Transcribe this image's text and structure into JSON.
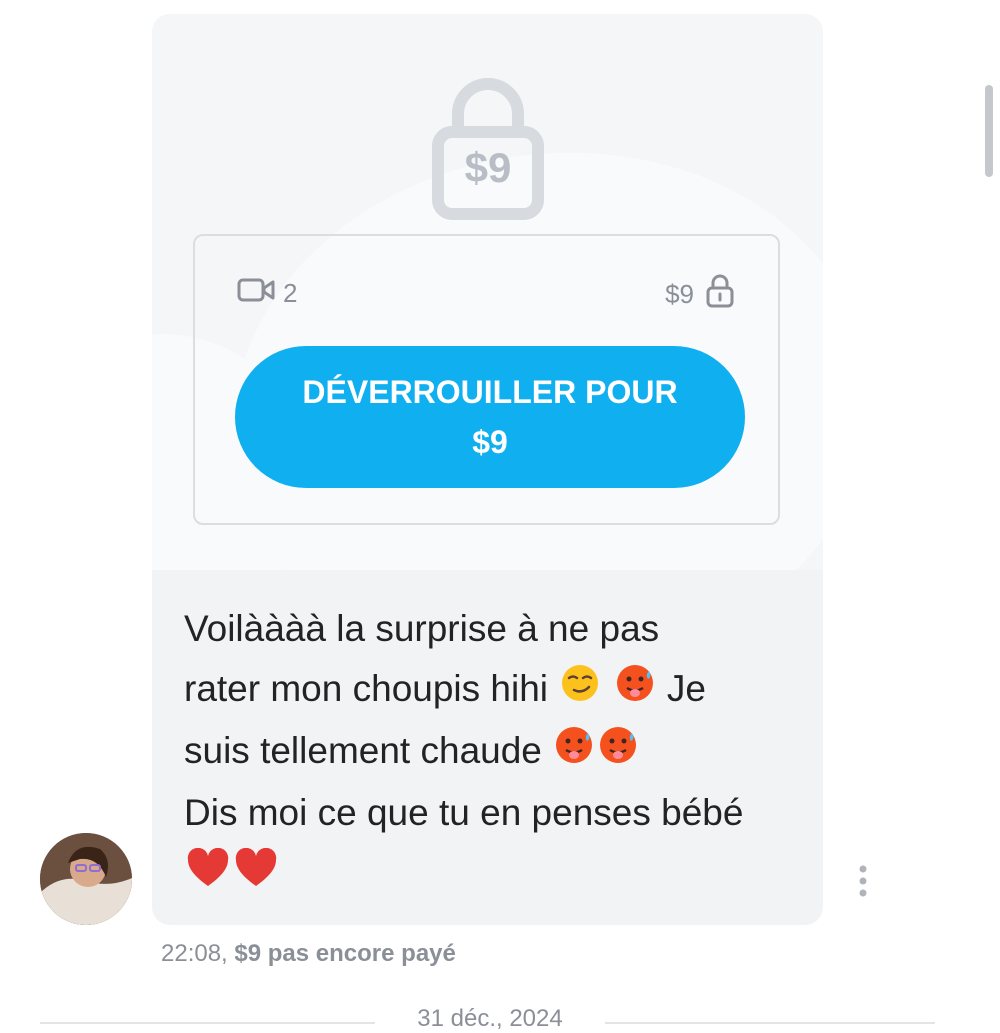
{
  "locked_post": {
    "lock_price": "$9",
    "video_count": "2",
    "price_label": "$9",
    "unlock_button": {
      "line1": "DÉVERROUILLER POUR",
      "line2": "$9"
    }
  },
  "message": {
    "line1": "Voilàààà la surprise à ne pas",
    "line2_text": "rater mon choupis hihi",
    "line2_suffix": "Je",
    "line3_text": "suis tellement chaude",
    "line4": "Dis moi ce que tu en penses bébé"
  },
  "meta": {
    "time": "22:08,",
    "payment_status": "$9 pas encore payé"
  },
  "date_separator": "31 déc., 2024",
  "colors": {
    "accent": "#10aff0",
    "card_bg": "#f2f3f5",
    "muted_text": "#8a8f98",
    "lock_icon": "#d7dade"
  },
  "icons": [
    "lock-icon",
    "video-icon",
    "small-lock-icon",
    "smirk-emoji",
    "hot-face-emoji",
    "red-heart-emoji",
    "more-vertical-icon"
  ]
}
